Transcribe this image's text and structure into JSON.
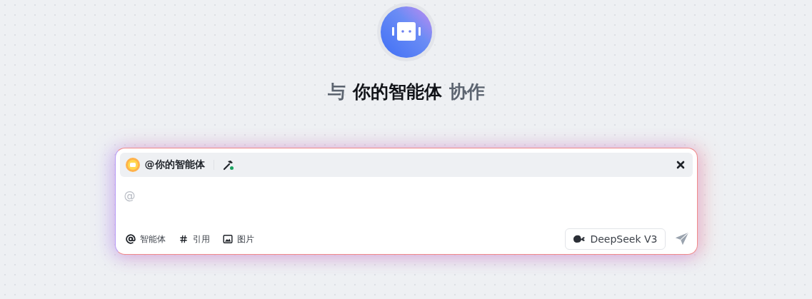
{
  "heading": {
    "before": "与",
    "agent": "你的智能体",
    "after": "协作"
  },
  "composer": {
    "mention": {
      "label": "@你的智能体"
    },
    "input": {
      "placeholder": "@"
    },
    "tools": [
      {
        "kind": "at",
        "label": "智能体"
      },
      {
        "kind": "hash",
        "label": "引用"
      },
      {
        "kind": "image",
        "label": "图片"
      }
    ],
    "model": {
      "label": "DeepSeek V3"
    }
  }
}
